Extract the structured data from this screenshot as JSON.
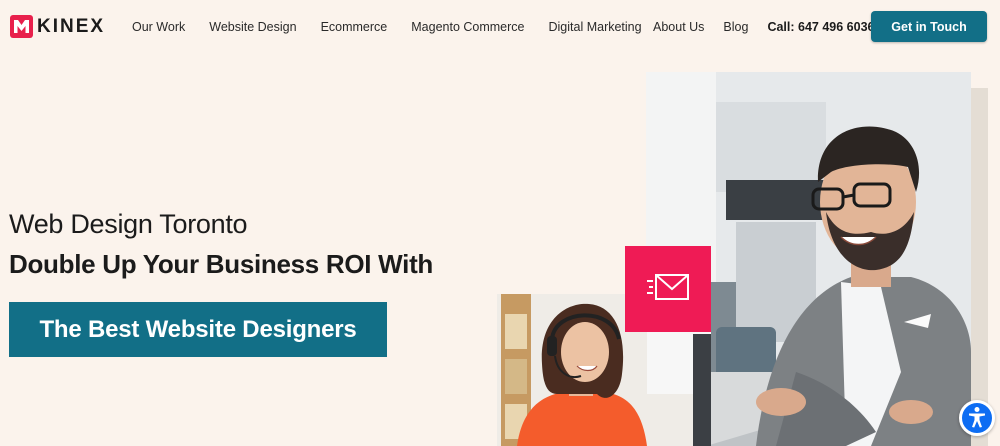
{
  "brand": {
    "name": "KINEX",
    "accent": "#e8204c",
    "primary": "#126f87",
    "background": "#fbf3ec"
  },
  "nav": {
    "left": [
      {
        "label": "Our Work"
      },
      {
        "label": "Website Design"
      },
      {
        "label": "Ecommerce"
      },
      {
        "label": "Magento Commerce"
      },
      {
        "label": "Digital Marketing"
      }
    ],
    "right": [
      {
        "label": "About Us"
      },
      {
        "label": "Blog"
      }
    ],
    "call": "Call: 647 496 6036",
    "cta": "Get in Touch"
  },
  "hero": {
    "eyebrow": "Web Design Toronto",
    "headline": "Double Up Your Business ROI With",
    "highlight": "The Best Website Designers"
  },
  "icons": {
    "mail": "mail-icon",
    "accessibility": "accessibility-icon"
  }
}
